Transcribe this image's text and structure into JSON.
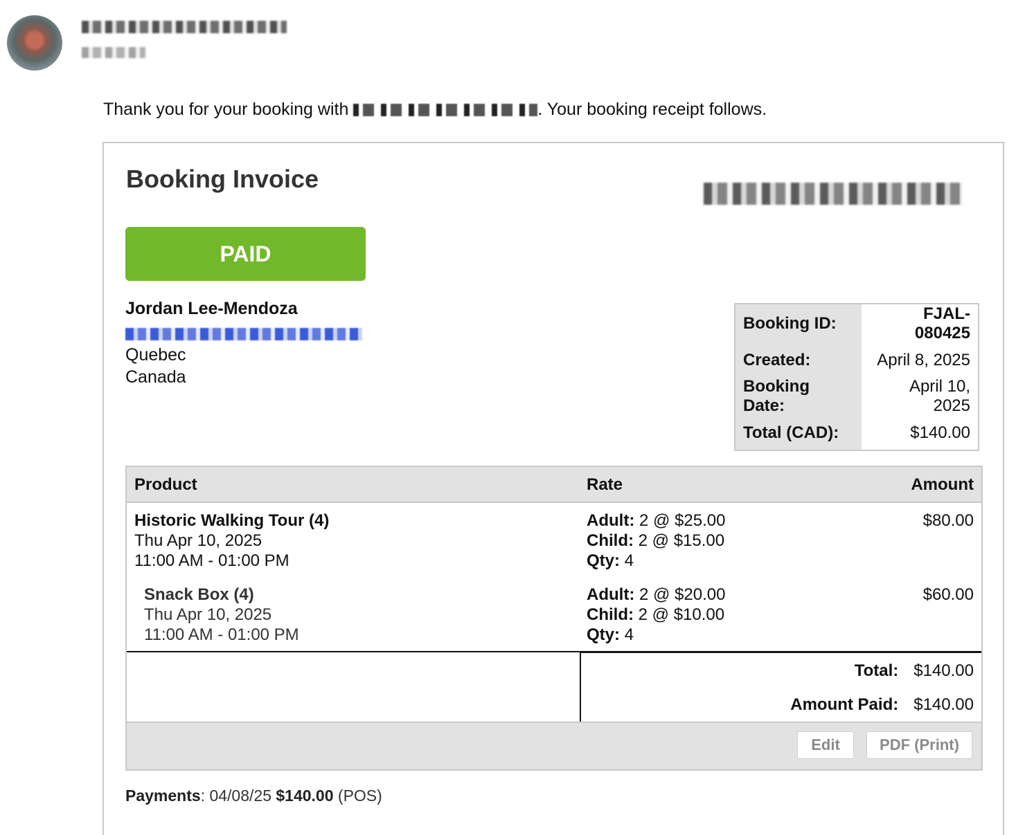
{
  "intro": {
    "prefix": "Thank you for your booking with",
    "suffix": ". Your booking receipt follows."
  },
  "invoice": {
    "title": "Booking Invoice",
    "status": "PAID",
    "status_color": "#72b82b"
  },
  "customer": {
    "name": "Jordan Lee-Mendoza",
    "region": "Quebec",
    "country": "Canada"
  },
  "meta": [
    {
      "label": "Booking ID:",
      "value": "FJAL-080425"
    },
    {
      "label": "Created:",
      "value": "April 8, 2025"
    },
    {
      "label": "Booking Date:",
      "value": "April 10, 2025"
    },
    {
      "label": "Total (CAD):",
      "value": "$140.00"
    }
  ],
  "table": {
    "headers": {
      "product": "Product",
      "rate": "Rate",
      "amount": "Amount"
    },
    "items": [
      {
        "name": "Historic Walking Tour (4)",
        "date": "Thu Apr 10, 2025",
        "time": "11:00 AM - 01:00 PM",
        "adult_label": "Adult:",
        "adult_rate": "2 @ $25.00",
        "child_label": "Child:",
        "child_rate": "2 @ $15.00",
        "qty_label": "Qty:",
        "qty": "4",
        "amount": "$80.00"
      },
      {
        "name": "Snack Box (4)",
        "date": "Thu Apr 10, 2025",
        "time": "11:00 AM - 01:00 PM",
        "adult_label": "Adult:",
        "adult_rate": "2 @ $20.00",
        "child_label": "Child:",
        "child_rate": "2 @ $10.00",
        "qty_label": "Qty:",
        "qty": "4",
        "amount": "$60.00"
      }
    ],
    "total_label": "Total:",
    "total_value": "$140.00",
    "paid_label": "Amount Paid:",
    "paid_value": "$140.00",
    "edit_label": "Edit",
    "pdf_label": "PDF (Print)"
  },
  "payments": {
    "label": "Payments",
    "date": "04/08/25",
    "amount": "$140.00",
    "method": "(POS)"
  }
}
